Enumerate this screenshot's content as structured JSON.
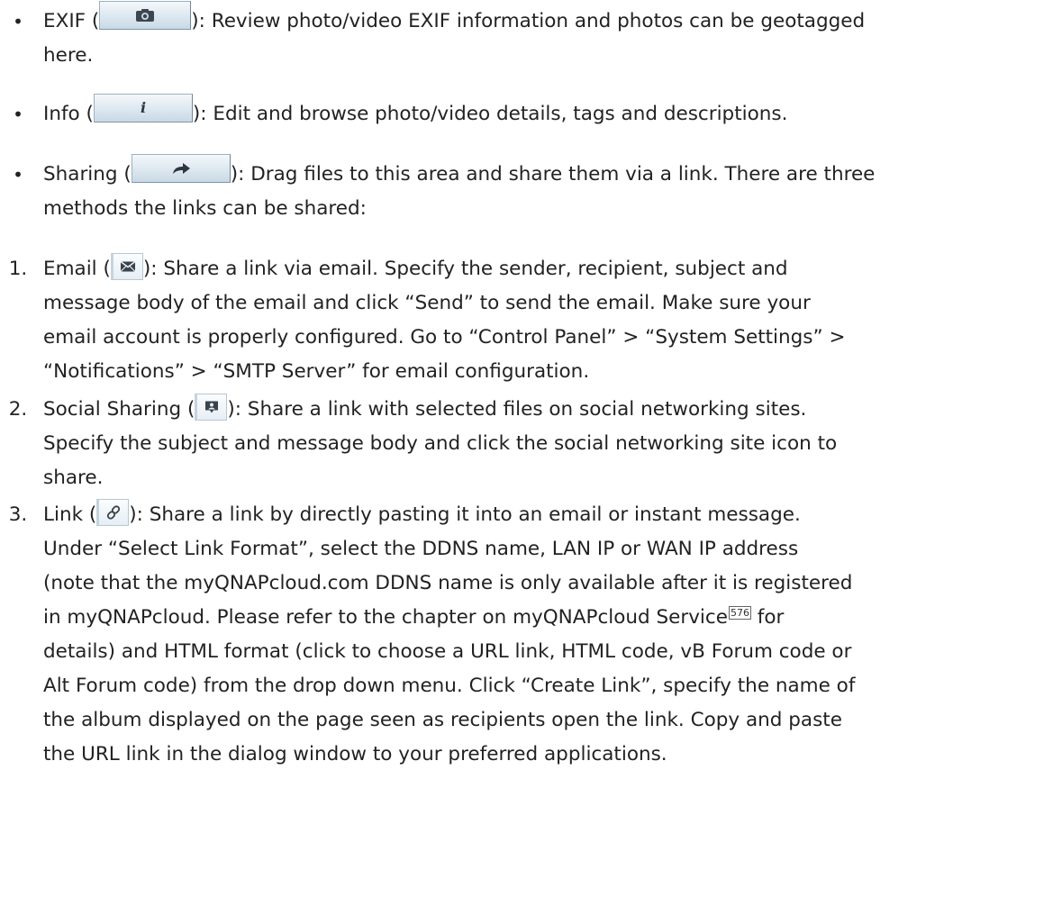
{
  "items": {
    "exif": {
      "marker": "•",
      "before": "EXIF (",
      "after": "): Review photo/video EXIF information and photos can be geotagged",
      "cont": "here.",
      "icon": "camera-icon"
    },
    "info": {
      "marker": "•",
      "before": "Info (",
      "after": "): Edit and browse photo/video details, tags and descriptions.",
      "icon": "info-icon"
    },
    "sharing": {
      "marker": "•",
      "before": "Sharing (",
      "after": "): Drag files to this area and share them via a link. There are three",
      "cont": "methods the links can be shared:",
      "icon": "share-arrow-icon"
    },
    "email": {
      "marker": "1.",
      "before": "Email (",
      "after": "): Share a link via email. Specify the sender, recipient, subject and",
      "lines": [
        "message body of the email and click “Send” to send the email. Make sure your",
        "email account is properly configured. Go to “Control Panel” > “System Settings” >",
        "“Notifications” > “SMTP Server” for email configuration."
      ],
      "icon": "envelope-icon"
    },
    "social": {
      "marker": "2.",
      "before": "Social Sharing (",
      "after": "): Share a link with selected files on social networking sites.",
      "lines": [
        "Specify the subject and message body and click the social networking site icon to",
        "share."
      ],
      "icon": "social-share-icon"
    },
    "link": {
      "marker": "3.",
      "before": "Link (",
      "after": "): Share a link by directly pasting it into an email or instant message.",
      "lines": [
        "Under “Select Link Format”, select the DDNS name, LAN IP or WAN IP address",
        "(note that the myQNAPcloud.com DDNS name is only available after it is registered"
      ],
      "line4_before": "in myQNAPcloud. Please refer to the chapter on myQNAPcloud Service",
      "line4_ref": "576",
      "line4_after": " for",
      "lines_end": [
        "details) and HTML format (click to choose a URL link, HTML code, vB Forum code or",
        "Alt Forum code) from the drop down menu. Click “Create Link”, specify the name of",
        "the album displayed on the page seen as recipients open the link. Copy and paste",
        "the URL link in the dialog window to your preferred applications."
      ],
      "icon": "chain-link-icon"
    }
  }
}
